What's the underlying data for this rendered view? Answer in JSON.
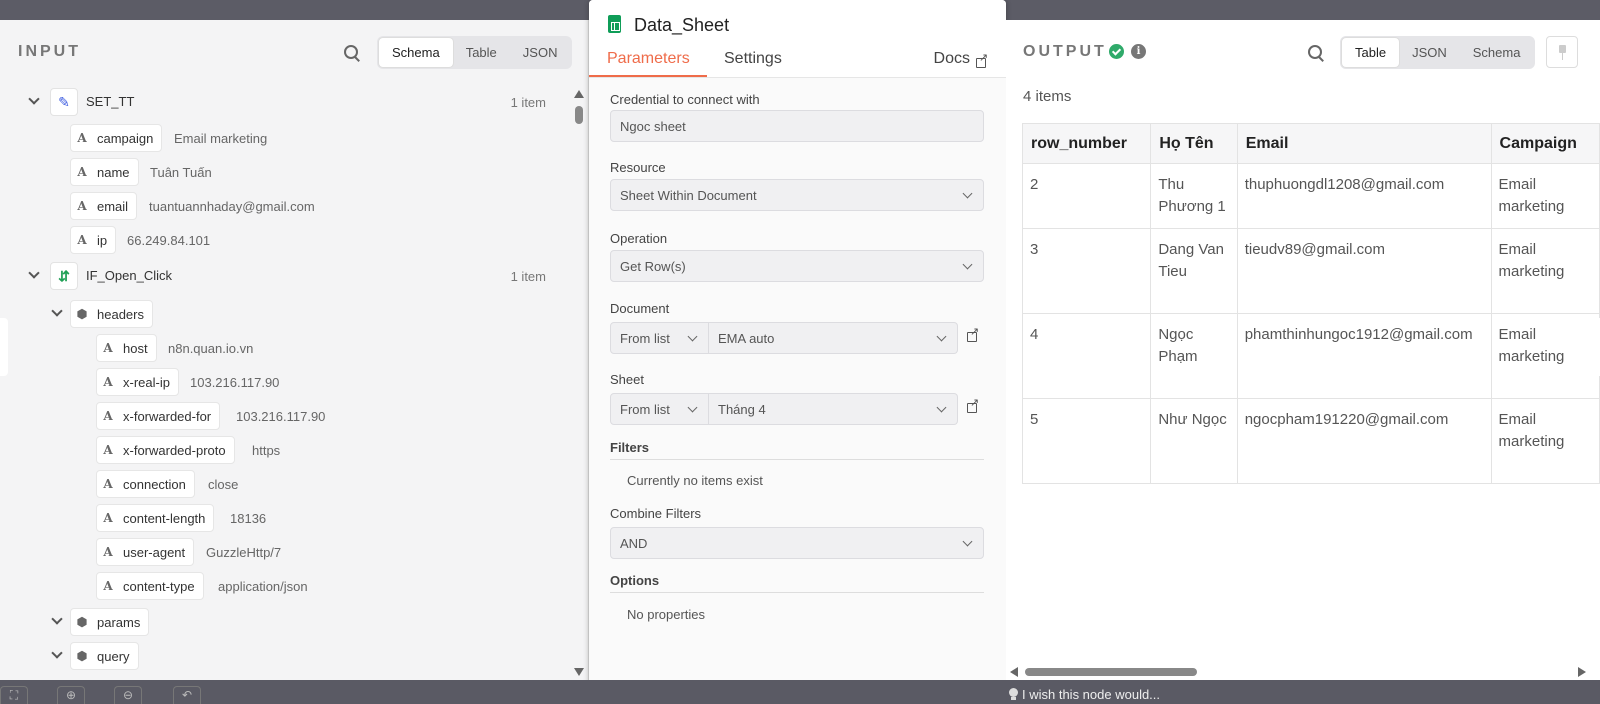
{
  "input": {
    "title": "INPUT",
    "view_tabs": [
      "Schema",
      "Table",
      "JSON"
    ],
    "active_view": "Schema",
    "nodes": [
      {
        "name": "SET_TT",
        "count": "1 item",
        "icon": "pencil-icon",
        "fields": [
          {
            "key": "campaign",
            "value": "Email marketing"
          },
          {
            "key": "name",
            "value": "Tuân Tuấn"
          },
          {
            "key": "email",
            "value": "tuantuannhaday@gmail.com"
          },
          {
            "key": "ip",
            "value": "66.249.84.101"
          }
        ]
      },
      {
        "name": "IF_Open_Click",
        "count": "1 item",
        "icon": "if-branch-icon",
        "groups": [
          {
            "name": "headers",
            "fields": [
              {
                "key": "host",
                "value": "n8n.quan.io.vn"
              },
              {
                "key": "x-real-ip",
                "value": "103.216.117.90"
              },
              {
                "key": "x-forwarded-for",
                "value": "103.216.117.90"
              },
              {
                "key": "x-forwarded-proto",
                "value": "https"
              },
              {
                "key": "connection",
                "value": "close"
              },
              {
                "key": "content-length",
                "value": "18136"
              },
              {
                "key": "user-agent",
                "value": "GuzzleHttp/7"
              },
              {
                "key": "content-type",
                "value": "application/json"
              }
            ]
          },
          {
            "name": "params"
          },
          {
            "name": "query"
          }
        ]
      }
    ],
    "type_glyph": "A"
  },
  "node": {
    "title": "Data_Sheet",
    "tabs": [
      "Parameters",
      "Settings"
    ],
    "docs_label": "Docs",
    "credential_label": "Credential to connect with",
    "credential_value": "Ngoc sheet",
    "resource_label": "Resource",
    "resource_value": "Sheet Within Document",
    "operation_label": "Operation",
    "operation_value": "Get Row(s)",
    "document_label": "Document",
    "document_mode": "From list",
    "document_value": "EMA auto",
    "sheet_label": "Sheet",
    "sheet_mode": "From list",
    "sheet_value": "Tháng 4",
    "filters_label": "Filters",
    "filters_empty": "Currently no items exist",
    "combine_label": "Combine Filters",
    "combine_value": "AND",
    "options_label": "Options",
    "options_empty": "No properties"
  },
  "output": {
    "title": "OUTPUT",
    "view_tabs": [
      "Table",
      "JSON",
      "Schema"
    ],
    "active_view": "Table",
    "items_count": "4 items",
    "columns": [
      "row_number",
      "Họ Tên",
      "Email",
      "Campaign"
    ],
    "rows": [
      [
        "2",
        "Thu Phương 1",
        "thuphuongdl1208@gmail.com",
        "Email marketing"
      ],
      [
        "3",
        "Dang Van Tieu",
        "tieudv89@gmail.com",
        "Email marketing"
      ],
      [
        "4",
        "Ngọc Phạm",
        "phamthinhungoc1912@gmail.com",
        "Email marketing"
      ],
      [
        "5",
        "Như Ngọc",
        "ngocpham191220@gmail.com",
        "Email marketing"
      ]
    ],
    "info_glyph": "i"
  },
  "feedback_text": "I wish this node would...",
  "colors": {
    "accent": "#ef6c4a",
    "success": "#2faa6a",
    "sheets_green": "#0f9d58"
  }
}
